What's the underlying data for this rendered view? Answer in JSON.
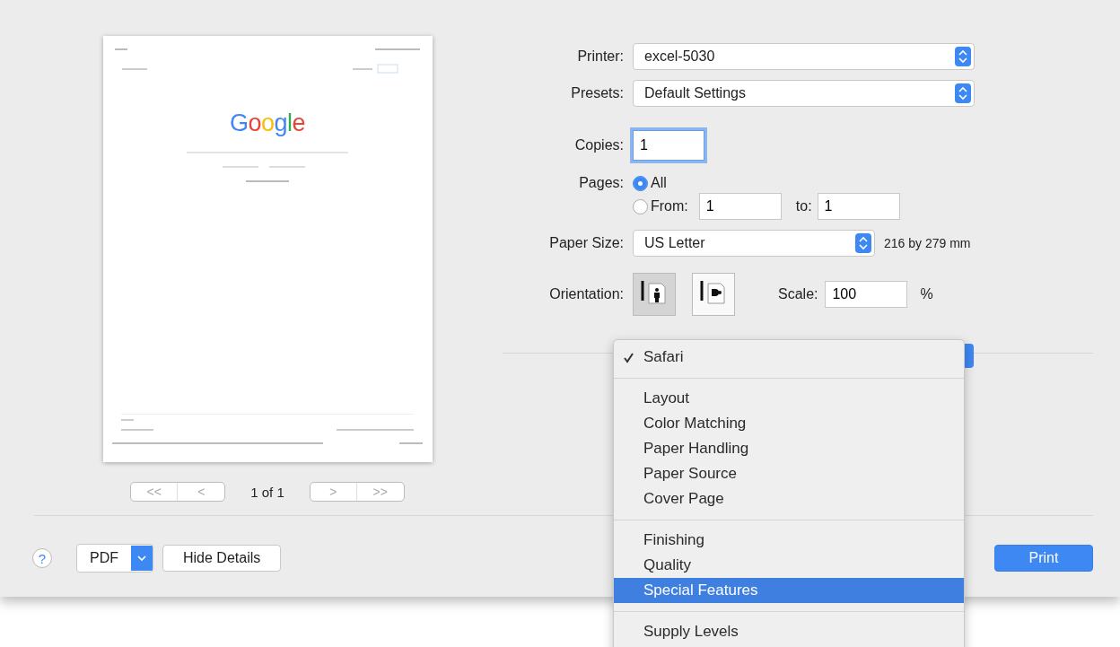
{
  "preview": {
    "logo": "Google",
    "nav": {
      "first": "<<",
      "prev": "<",
      "label": "1 of 1",
      "next": ">",
      "last": ">>"
    }
  },
  "printer": {
    "label": "Printer:",
    "value": "excel-5030"
  },
  "presets": {
    "label": "Presets:",
    "value": "Default Settings"
  },
  "copies": {
    "label": "Copies:",
    "value": "1"
  },
  "pages": {
    "label": "Pages:",
    "options": [
      {
        "label": "All",
        "selected": true
      },
      {
        "label": "From:",
        "selected": false
      }
    ],
    "from": "1",
    "to_label": "to:",
    "to": "1"
  },
  "paper_size": {
    "label": "Paper Size:",
    "value": "US Letter",
    "dimensions": "216 by 279 mm"
  },
  "orientation": {
    "label": "Orientation:",
    "options": [
      {
        "kind": "portrait",
        "selected": true
      },
      {
        "kind": "landscape",
        "selected": false
      }
    ]
  },
  "scale": {
    "label": "Scale:",
    "value": "100",
    "unit": "%"
  },
  "menu": [
    [
      {
        "label": "Safari",
        "checked": true,
        "selected": false
      }
    ],
    [
      {
        "label": "Layout",
        "checked": false,
        "selected": false
      },
      {
        "label": "Color Matching",
        "checked": false,
        "selected": false
      },
      {
        "label": "Paper Handling",
        "checked": false,
        "selected": false
      },
      {
        "label": "Paper Source",
        "checked": false,
        "selected": false
      },
      {
        "label": "Cover Page",
        "checked": false,
        "selected": false
      }
    ],
    [
      {
        "label": "Finishing",
        "checked": false,
        "selected": false
      },
      {
        "label": "Quality",
        "checked": false,
        "selected": false
      },
      {
        "label": "Special Features",
        "checked": false,
        "selected": true
      }
    ],
    [
      {
        "label": "Supply Levels",
        "checked": false,
        "selected": false
      }
    ]
  ],
  "buttons": {
    "help": "?",
    "pdf": "PDF",
    "details": "Hide Details",
    "print": "Print"
  }
}
